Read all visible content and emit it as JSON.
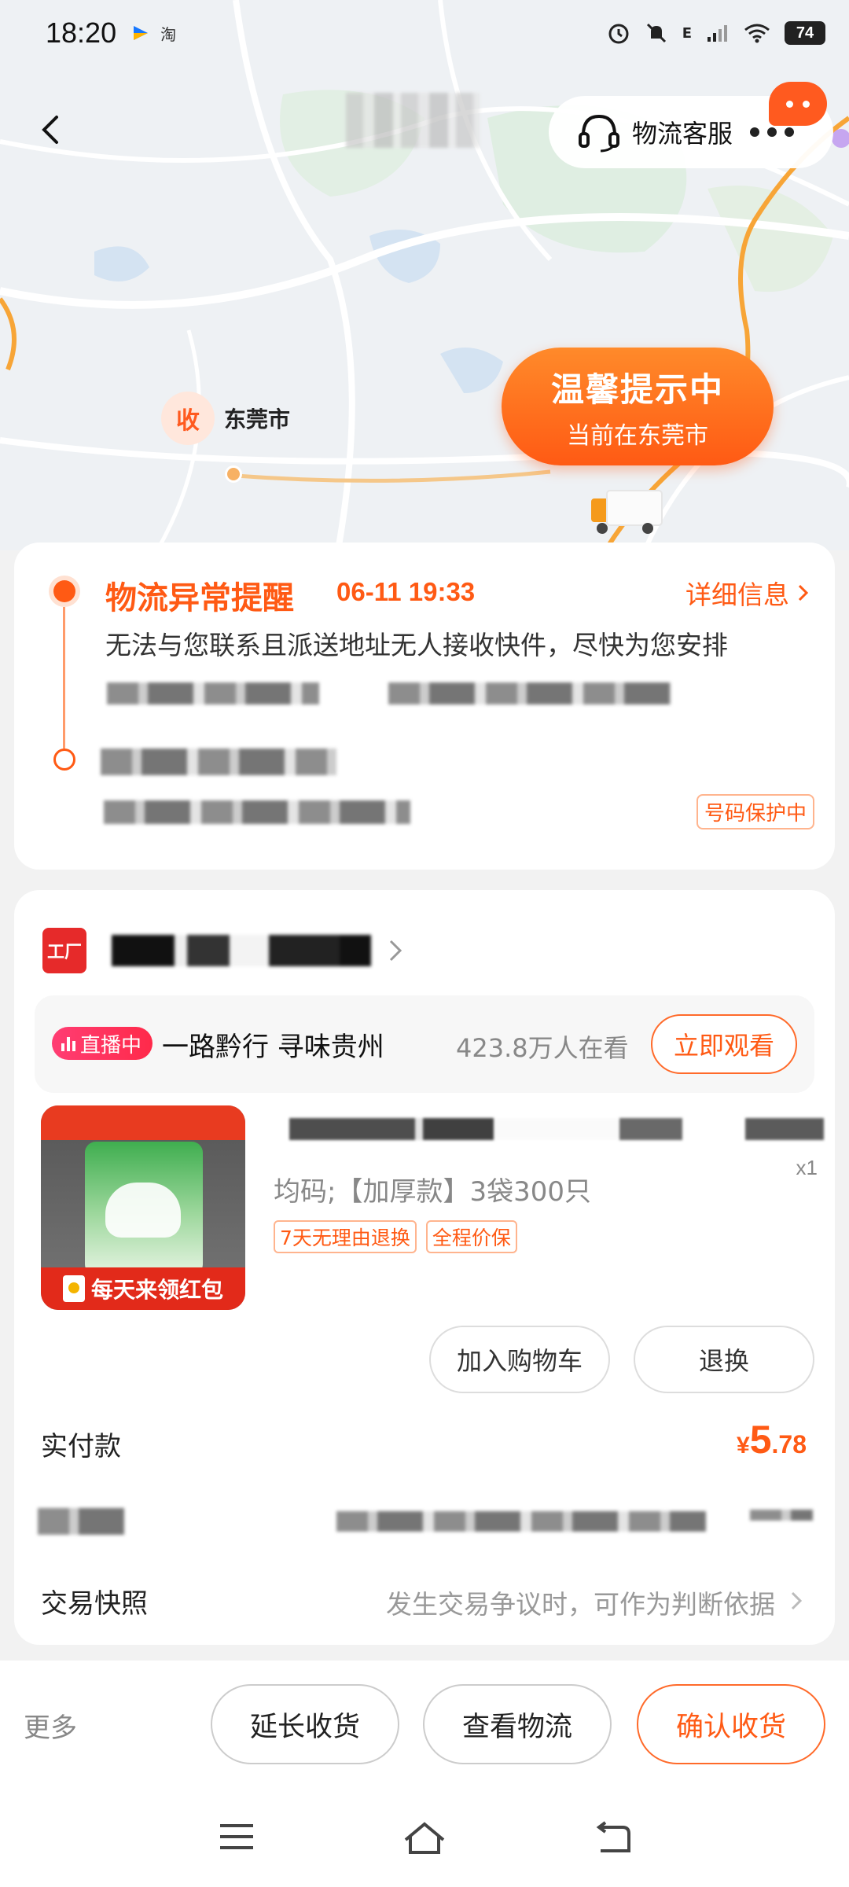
{
  "status_bar": {
    "time": "18:20",
    "app_icon_text": "淘",
    "signal_type": "E",
    "battery": "74"
  },
  "map": {
    "destination_badge": "收",
    "destination_city": "东莞市",
    "tip_title": "温馨提示中",
    "tip_subtitle": "当前在东莞市"
  },
  "header": {
    "service_label": "物流客服"
  },
  "logistics": {
    "alert_title": "物流异常提醒",
    "alert_time": "06-11 19:33",
    "detail_link": "详细信息",
    "alert_desc": "无法与您联系且派送地址无人接收快件，尽快为您安排",
    "protect_badge": "号码保护中"
  },
  "order": {
    "shop_icon_text": "工厂",
    "live": {
      "badge": "直播中",
      "title": "一路黔行 寻味贵州",
      "viewers": "423.8万人在看",
      "watch_button": "立即观看"
    },
    "product": {
      "banner_text": "每天来领红包",
      "spec": "均码;【加厚款】3袋300只",
      "quantity": "x1",
      "tags": [
        "7天无理由退换",
        "全程价保"
      ]
    },
    "buttons": {
      "add_to_cart": "加入购物车",
      "return_exchange": "退换"
    },
    "paid_label": "实付款",
    "paid_symbol": "¥",
    "paid_int": "5",
    "paid_dec": ".78",
    "snapshot_label": "交易快照",
    "snapshot_hint": "发生交易争议时，可作为判断依据"
  },
  "bottom_bar": {
    "more": "更多",
    "extend": "延长收货",
    "view_logistics": "查看物流",
    "confirm": "确认收货"
  },
  "colors": {
    "accent": "#ff5a14",
    "live_pink": "#ff2a4a",
    "shop_red": "#e62a2a"
  }
}
